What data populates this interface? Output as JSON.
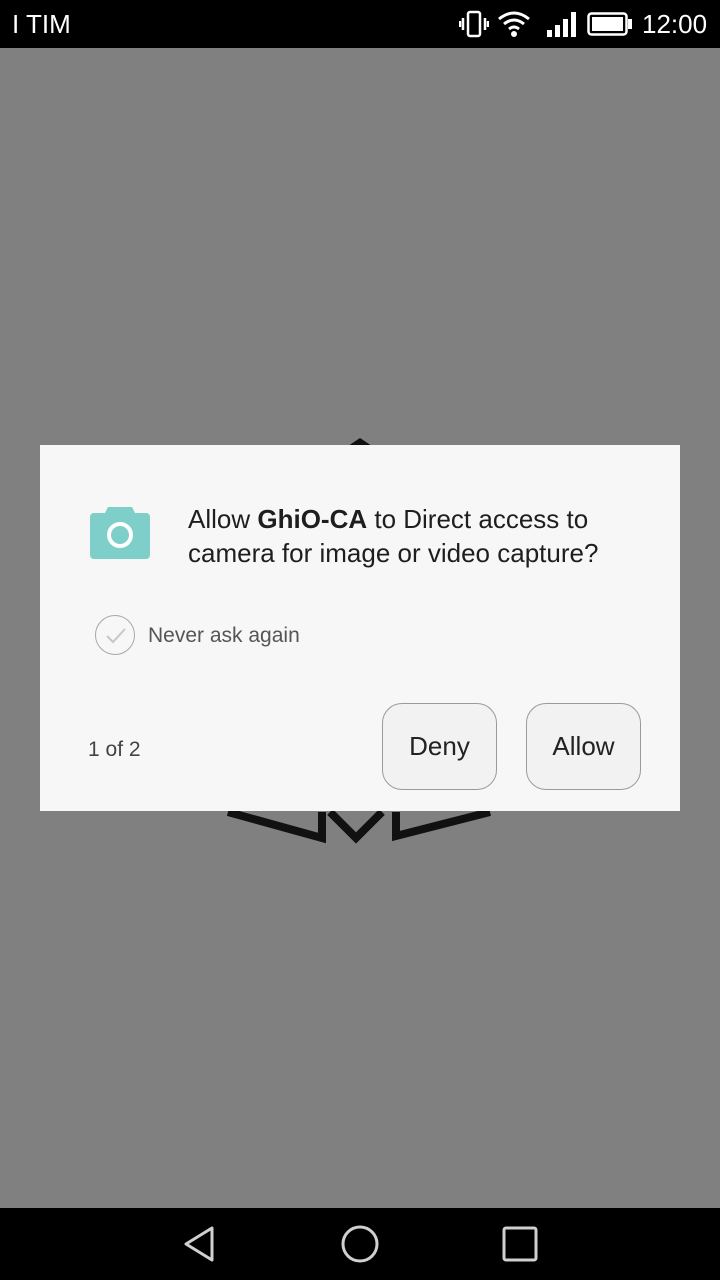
{
  "status_bar": {
    "carrier": "I TIM",
    "time": "12:00",
    "icons": [
      "vibrate-icon",
      "wifi-icon",
      "signal-icon",
      "battery-icon"
    ]
  },
  "dialog": {
    "message_prefix": "Allow ",
    "app_name": "GhiO-CA",
    "message_suffix": " to Direct access to camera for image or video capture?",
    "icon": "camera-icon",
    "never_ask_label": "Never ask again",
    "never_ask_checked": false,
    "counter": "1 of 2",
    "deny_label": "Deny",
    "allow_label": "Allow"
  },
  "nav_bar": {
    "buttons": [
      "back-icon",
      "home-icon",
      "recents-icon"
    ]
  },
  "colors": {
    "scrim": "#808080",
    "dialog_bg": "#f7f7f7",
    "accent_camera": "#7ecfc9",
    "bar_bg": "#000000"
  }
}
